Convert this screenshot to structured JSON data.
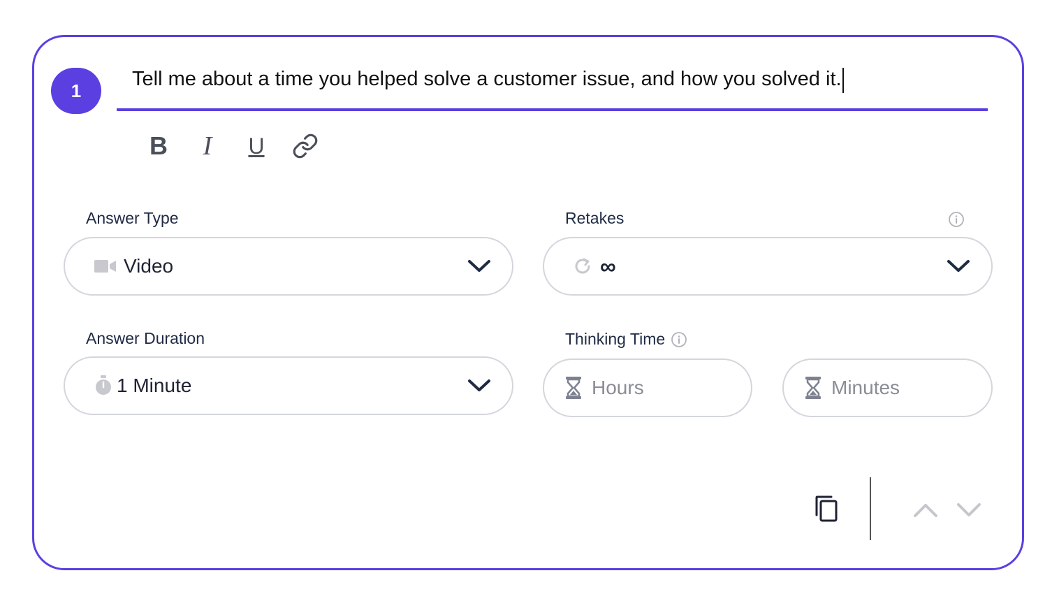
{
  "question": {
    "number": "1",
    "text": "Tell me about a time you helped solve a customer issue, and how you solved it."
  },
  "toolbar": {
    "bold": "B",
    "italic": "I",
    "underline": "U"
  },
  "answer_type": {
    "label": "Answer Type",
    "value": "Video",
    "icon": "video-camera-icon"
  },
  "retakes": {
    "label": "Retakes",
    "value": "∞",
    "icon": "retry-icon"
  },
  "answer_duration": {
    "label": "Answer Duration",
    "value": "1 Minute",
    "icon": "stopwatch-icon"
  },
  "thinking_time": {
    "label": "Thinking Time",
    "hours_placeholder": "Hours",
    "minutes_placeholder": "Minutes",
    "icon": "hourglass-icon"
  },
  "colors": {
    "accent": "#5b3fe0",
    "border": "#d4d6dc",
    "muted_icon": "#b9bbc2"
  }
}
